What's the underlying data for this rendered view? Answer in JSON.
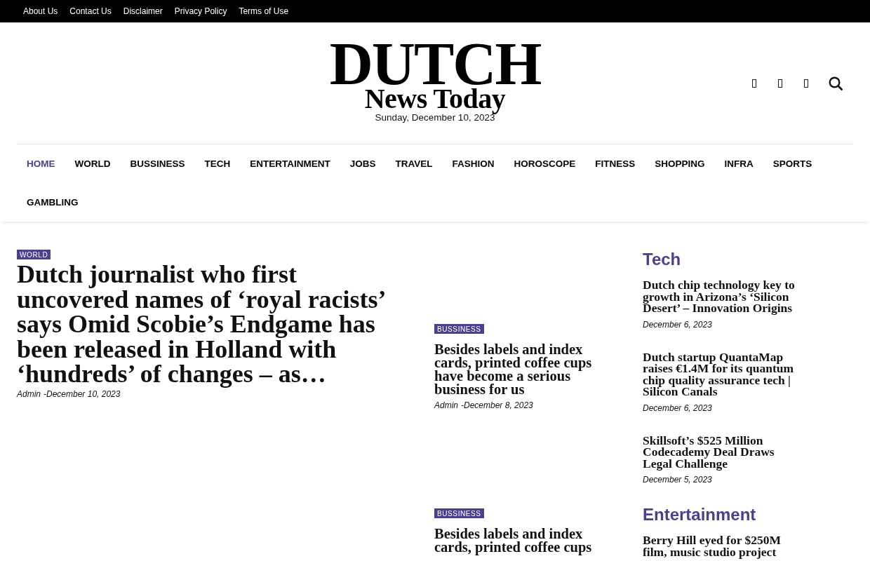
{
  "top_bar": {
    "links": [
      "About Us",
      "Contact Us",
      "Disclaimer",
      "Privacy Policy",
      "Terms of Use"
    ]
  },
  "header": {
    "logo": {
      "title": "DUTCH",
      "subtitle": "News Today"
    },
    "date": "Sunday, December 10, 2023"
  },
  "nav": {
    "items": [
      {
        "label": "HOME",
        "selected": true
      },
      {
        "label": "WORLD",
        "selected": false
      },
      {
        "label": "BUSSINESS",
        "selected": false
      },
      {
        "label": "TECH",
        "selected": false
      },
      {
        "label": "ENTERTAINMENT",
        "selected": false
      },
      {
        "label": "JOBS",
        "selected": false
      },
      {
        "label": "TRAVEL",
        "selected": false
      },
      {
        "label": "FASHION",
        "selected": false
      },
      {
        "label": "HOROSCOPE",
        "selected": false
      },
      {
        "label": "FITNESS",
        "selected": false
      },
      {
        "label": "SHOPPING",
        "selected": false
      },
      {
        "label": "INFRA",
        "selected": false
      },
      {
        "label": "SPORTS",
        "selected": false
      },
      {
        "label": "GAMBLING",
        "selected": false
      }
    ]
  },
  "featured": {
    "category": "WORLD",
    "title": "Dutch journalist who first uncovered names of ‘royal racists’ says Omid Scobie’s Endgame has been released in Holland with ‘hundreds’ of changes – as…",
    "author": "Admin",
    "separator": "-",
    "date": "December 10, 2023"
  },
  "middle_articles": [
    {
      "category": "BUSSINESS",
      "title": "Besides labels and index cards, printed coffee cups have become a serious business for us",
      "author": "Admin",
      "separator": "-",
      "date": "December 8, 2023"
    },
    {
      "category": "BUSSINESS",
      "title": "Besides labels and index cards, printed coffee cups"
    }
  ],
  "sidebar": {
    "sections": [
      {
        "heading": "Tech",
        "items": [
          {
            "title": "Dutch chip technology key to growth in Arizona’s ‘Silicon Desert’ – Innovation Origins",
            "date": "December 6, 2023"
          },
          {
            "title": "Dutch startup QuantaMap raises €1.4M for its quantum chip quality assurance tech | Silicon Canals",
            "date": "December 6, 2023"
          },
          {
            "title": "Skillsoft’s $525 Million Codecademy Deal Draws Legal Challenge",
            "date": "December 5, 2023"
          }
        ]
      },
      {
        "heading": "Entertainment",
        "items": [
          {
            "title": "Berry Hill eyed for $250M film, music studio project"
          }
        ]
      }
    ]
  }
}
